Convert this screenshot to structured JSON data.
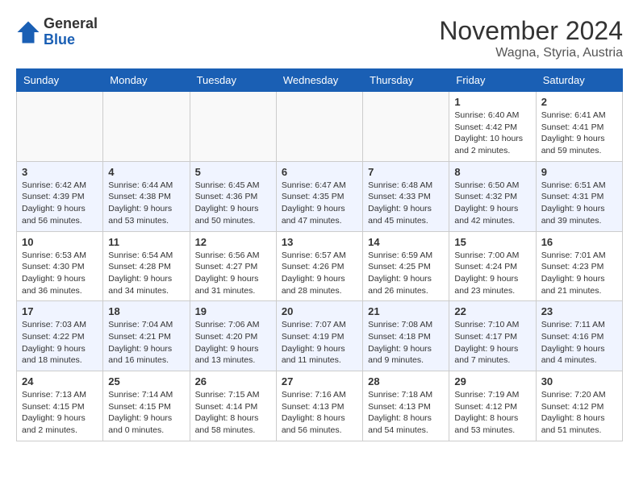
{
  "logo": {
    "general": "General",
    "blue": "Blue"
  },
  "title": "November 2024",
  "location": "Wagna, Styria, Austria",
  "weekdays": [
    "Sunday",
    "Monday",
    "Tuesday",
    "Wednesday",
    "Thursday",
    "Friday",
    "Saturday"
  ],
  "weeks": [
    [
      {
        "day": "",
        "info": ""
      },
      {
        "day": "",
        "info": ""
      },
      {
        "day": "",
        "info": ""
      },
      {
        "day": "",
        "info": ""
      },
      {
        "day": "",
        "info": ""
      },
      {
        "day": "1",
        "info": "Sunrise: 6:40 AM\nSunset: 4:42 PM\nDaylight: 10 hours and 2 minutes."
      },
      {
        "day": "2",
        "info": "Sunrise: 6:41 AM\nSunset: 4:41 PM\nDaylight: 9 hours and 59 minutes."
      }
    ],
    [
      {
        "day": "3",
        "info": "Sunrise: 6:42 AM\nSunset: 4:39 PM\nDaylight: 9 hours and 56 minutes."
      },
      {
        "day": "4",
        "info": "Sunrise: 6:44 AM\nSunset: 4:38 PM\nDaylight: 9 hours and 53 minutes."
      },
      {
        "day": "5",
        "info": "Sunrise: 6:45 AM\nSunset: 4:36 PM\nDaylight: 9 hours and 50 minutes."
      },
      {
        "day": "6",
        "info": "Sunrise: 6:47 AM\nSunset: 4:35 PM\nDaylight: 9 hours and 47 minutes."
      },
      {
        "day": "7",
        "info": "Sunrise: 6:48 AM\nSunset: 4:33 PM\nDaylight: 9 hours and 45 minutes."
      },
      {
        "day": "8",
        "info": "Sunrise: 6:50 AM\nSunset: 4:32 PM\nDaylight: 9 hours and 42 minutes."
      },
      {
        "day": "9",
        "info": "Sunrise: 6:51 AM\nSunset: 4:31 PM\nDaylight: 9 hours and 39 minutes."
      }
    ],
    [
      {
        "day": "10",
        "info": "Sunrise: 6:53 AM\nSunset: 4:30 PM\nDaylight: 9 hours and 36 minutes."
      },
      {
        "day": "11",
        "info": "Sunrise: 6:54 AM\nSunset: 4:28 PM\nDaylight: 9 hours and 34 minutes."
      },
      {
        "day": "12",
        "info": "Sunrise: 6:56 AM\nSunset: 4:27 PM\nDaylight: 9 hours and 31 minutes."
      },
      {
        "day": "13",
        "info": "Sunrise: 6:57 AM\nSunset: 4:26 PM\nDaylight: 9 hours and 28 minutes."
      },
      {
        "day": "14",
        "info": "Sunrise: 6:59 AM\nSunset: 4:25 PM\nDaylight: 9 hours and 26 minutes."
      },
      {
        "day": "15",
        "info": "Sunrise: 7:00 AM\nSunset: 4:24 PM\nDaylight: 9 hours and 23 minutes."
      },
      {
        "day": "16",
        "info": "Sunrise: 7:01 AM\nSunset: 4:23 PM\nDaylight: 9 hours and 21 minutes."
      }
    ],
    [
      {
        "day": "17",
        "info": "Sunrise: 7:03 AM\nSunset: 4:22 PM\nDaylight: 9 hours and 18 minutes."
      },
      {
        "day": "18",
        "info": "Sunrise: 7:04 AM\nSunset: 4:21 PM\nDaylight: 9 hours and 16 minutes."
      },
      {
        "day": "19",
        "info": "Sunrise: 7:06 AM\nSunset: 4:20 PM\nDaylight: 9 hours and 13 minutes."
      },
      {
        "day": "20",
        "info": "Sunrise: 7:07 AM\nSunset: 4:19 PM\nDaylight: 9 hours and 11 minutes."
      },
      {
        "day": "21",
        "info": "Sunrise: 7:08 AM\nSunset: 4:18 PM\nDaylight: 9 hours and 9 minutes."
      },
      {
        "day": "22",
        "info": "Sunrise: 7:10 AM\nSunset: 4:17 PM\nDaylight: 9 hours and 7 minutes."
      },
      {
        "day": "23",
        "info": "Sunrise: 7:11 AM\nSunset: 4:16 PM\nDaylight: 9 hours and 4 minutes."
      }
    ],
    [
      {
        "day": "24",
        "info": "Sunrise: 7:13 AM\nSunset: 4:15 PM\nDaylight: 9 hours and 2 minutes."
      },
      {
        "day": "25",
        "info": "Sunrise: 7:14 AM\nSunset: 4:15 PM\nDaylight: 9 hours and 0 minutes."
      },
      {
        "day": "26",
        "info": "Sunrise: 7:15 AM\nSunset: 4:14 PM\nDaylight: 8 hours and 58 minutes."
      },
      {
        "day": "27",
        "info": "Sunrise: 7:16 AM\nSunset: 4:13 PM\nDaylight: 8 hours and 56 minutes."
      },
      {
        "day": "28",
        "info": "Sunrise: 7:18 AM\nSunset: 4:13 PM\nDaylight: 8 hours and 54 minutes."
      },
      {
        "day": "29",
        "info": "Sunrise: 7:19 AM\nSunset: 4:12 PM\nDaylight: 8 hours and 53 minutes."
      },
      {
        "day": "30",
        "info": "Sunrise: 7:20 AM\nSunset: 4:12 PM\nDaylight: 8 hours and 51 minutes."
      }
    ]
  ]
}
